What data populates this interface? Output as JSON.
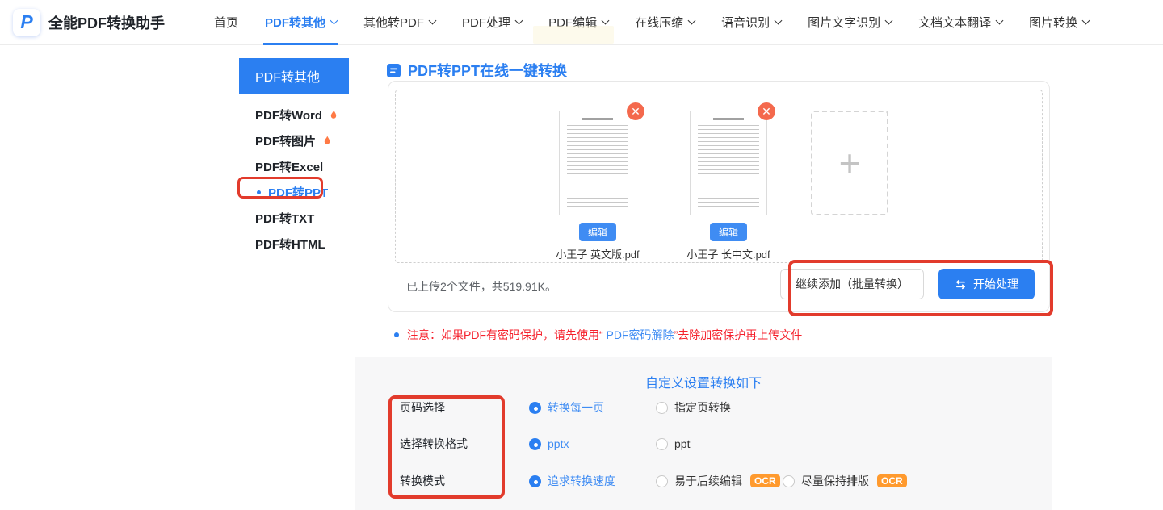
{
  "brand": {
    "logo_letter": "P",
    "title": "全能PDF转换助手"
  },
  "nav": {
    "items": [
      {
        "label": "首页"
      },
      {
        "label": "PDF转其他"
      },
      {
        "label": "其他转PDF"
      },
      {
        "label": "PDF处理"
      },
      {
        "label": "PDF编辑"
      },
      {
        "label": "在线压缩"
      },
      {
        "label": "语音识别"
      },
      {
        "label": "图片文字识别"
      },
      {
        "label": "文档文本翻译"
      },
      {
        "label": "图片转换"
      }
    ]
  },
  "sidebar": {
    "header": "PDF转其他",
    "items": [
      {
        "label": "PDF转Word"
      },
      {
        "label": "PDF转图片"
      },
      {
        "label": "PDF转Excel"
      },
      {
        "label": "PDF转PPT"
      },
      {
        "label": "PDF转TXT"
      },
      {
        "label": "PDF转HTML"
      }
    ]
  },
  "main": {
    "title": "PDF转PPT在线一键转换",
    "uploader": {
      "files": [
        {
          "name": "小王子 英文版.pdf",
          "edit_label": "编辑",
          "close_label": "✕"
        },
        {
          "name": "小王子 长中文.pdf",
          "edit_label": "编辑",
          "close_label": "✕"
        }
      ],
      "add_plus": "+",
      "status": "已上传2个文件，共519.91K。",
      "add_more_label": "继续添加（批量转换）",
      "start_label": "开始处理"
    },
    "note": {
      "prefix": "注意：如果PDF有密码保护，请先使用“",
      "link": " PDF密码解除",
      "suffix": "”去除加密保护再上传文件"
    },
    "settings": {
      "title": "自定义设置转换如下",
      "rows": [
        {
          "label": "页码选择",
          "options": [
            {
              "label": "转换每一页",
              "selected": true
            },
            {
              "label": "指定页转换",
              "selected": false
            }
          ]
        },
        {
          "label": "选择转换格式",
          "options": [
            {
              "label": "pptx",
              "selected": true
            },
            {
              "label": "ppt",
              "selected": false
            }
          ]
        },
        {
          "label": "转换模式",
          "options": [
            {
              "label": "追求转换速度",
              "selected": true
            },
            {
              "label": "易于后续编辑",
              "selected": false,
              "badge": "OCR"
            },
            {
              "label": "尽量保持排版",
              "selected": false,
              "badge": "OCR"
            }
          ]
        }
      ]
    }
  },
  "colors": {
    "primary": "#2b7ff1",
    "annotation_red": "#e23b2c",
    "note_red": "#f5222d",
    "link_blue": "#3f8cf3",
    "ocr_badge": "#ff9a2e",
    "flame_orange": "#ff7a45"
  }
}
